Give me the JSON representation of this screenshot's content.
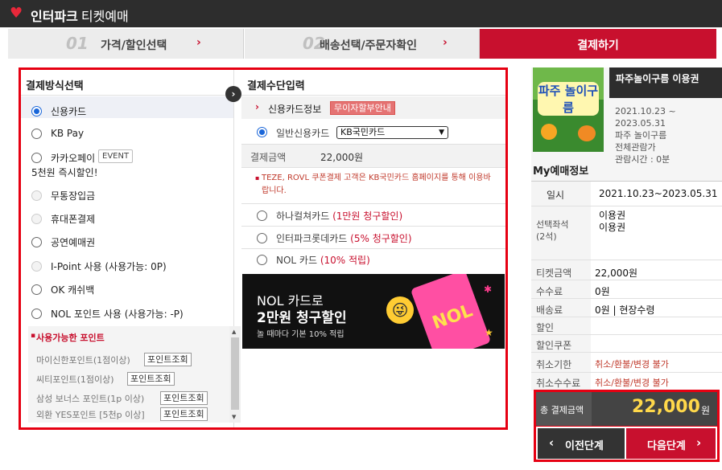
{
  "header": {
    "brand": "인터파크",
    "brand_sub": "티켓예매"
  },
  "steps": [
    {
      "num": "01",
      "label": "가격/할인선택"
    },
    {
      "num": "02",
      "label": "배송선택/주문자확인"
    },
    {
      "label": "결제하기"
    }
  ],
  "payment_method": {
    "title": "결제방식선택",
    "options": [
      {
        "label": "신용카드",
        "checked": true
      },
      {
        "label": "KB Pay"
      },
      {
        "label": "카카오페이",
        "badge": "EVENT",
        "note": "5천원 즉시할인!"
      },
      {
        "label": "무통장입금"
      },
      {
        "label": "휴대폰결제"
      },
      {
        "label": "공연예매권"
      },
      {
        "label": "I-Point 사용 (사용가능: 0P)"
      },
      {
        "label": "OK 캐쉬백"
      },
      {
        "label": "NOL 포인트 사용 (사용가능: -P)"
      }
    ],
    "points": {
      "title": "사용가능한 포인트",
      "rows": [
        {
          "label": "마이신한포인트(1점이상)",
          "button": "포인트조회"
        },
        {
          "label": "씨티포인트(1점이상)",
          "button": "포인트조회"
        },
        {
          "label": "삼성 보너스 포인트(1p 이상)",
          "button": "포인트조회"
        },
        {
          "label": "외환 YES포인트 [5천p 이상]",
          "button": "포인트조회"
        }
      ]
    }
  },
  "payment_input": {
    "title": "결제수단입력",
    "card_info_label": "신용카드정보",
    "interest_free_btn": "무이자할부안내",
    "general_card_label": "일반신용카드",
    "card_select_value": "KB국민카드",
    "amount_label": "결제금액",
    "amount_value": "22,000원",
    "notice": "TEZE, ROVL 쿠폰결제 고객은 KB국민카드 홈페이지를 통해 이용바랍니다.",
    "other_cards": [
      {
        "label": "하나컬쳐카드",
        "promo": "(1만원 청구할인)"
      },
      {
        "label": "인터파크롯데카드",
        "promo": "(5% 청구할인)"
      },
      {
        "label": "NOL 카드",
        "promo": "(10% 적립)"
      }
    ],
    "banner": {
      "line1": "NOL 카드로",
      "line2": "2만원 청구할인",
      "line3": "놀 때마다 기본 10% 적립",
      "card_text": "NOL"
    }
  },
  "product": {
    "title": "파주놀이구름 이용권",
    "poster_text": "파주 놀이구름",
    "details": [
      "2021.10.23 ~",
      "2023.05.31",
      "파주 놀이구름",
      "전체관람가",
      "관람시간 : 0분"
    ]
  },
  "my_booking": {
    "title": "My예매정보",
    "rows": [
      {
        "label": "일시",
        "value": "2021.10.23~2023.05.31"
      },
      {
        "label": "선택좌석\n(2석)",
        "value": "이용권\n이용권"
      },
      {
        "label": "티켓금액",
        "value": "22,000원"
      },
      {
        "label": "수수료",
        "value": "0원"
      },
      {
        "label": "배송료",
        "value": "0원 | 현장수령"
      },
      {
        "label": "할인",
        "value": ""
      },
      {
        "label": "할인쿠폰",
        "value": ""
      },
      {
        "label": "취소기한",
        "value": "취소/환불/변경 불가"
      },
      {
        "label": "취소수수료",
        "value": "취소/환불/변경 불가"
      }
    ]
  },
  "total": {
    "label": "총 결제금액",
    "amount": "22,000",
    "unit": "원"
  },
  "nav": {
    "prev": "이전단계",
    "next": "다음단계"
  },
  "colors": {
    "accent_red": "#c8102e",
    "highlight_red": "#e60012",
    "total_yellow": "#ffd84a"
  }
}
